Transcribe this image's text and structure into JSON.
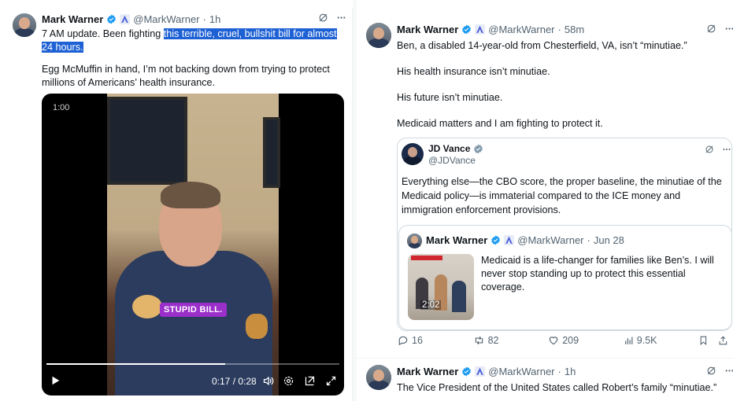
{
  "left_tweet": {
    "author_name": "Mark Warner",
    "handle": "@MarkWarner",
    "time": "1h",
    "text_plain": "7 AM update. Been fighting ",
    "text_highlight": "this terrible, cruel, bullshit bill for almost 24 hours.",
    "text_p2": "Egg McMuffin in hand, I’m not backing down from trying to protect millions of Americans’ health insurance.",
    "video": {
      "corner_time": "1:00",
      "caption": "STUPID BILL.",
      "time_display": "0:17 / 0:28",
      "progress": 0.61
    }
  },
  "right_tweet": {
    "author_name": "Mark Warner",
    "handle": "@MarkWarner",
    "time": "58m",
    "lines": [
      "Ben, a disabled 14-year-old from Chesterfield, VA, isn’t “minutiae.”",
      "His health insurance isn’t minutiae.",
      "His future isn’t minutiae.",
      "Medicaid matters and I am fighting to protect it."
    ],
    "quote": {
      "author_name": "JD Vance",
      "handle": "@JDVance",
      "text": "Everything else—the CBO score, the proper baseline, the minutiae of the Medicaid policy—is immaterial compared to the ICE money and immigration enforcement provisions.",
      "nested": {
        "author_name": "Mark Warner",
        "handle": "@MarkWarner",
        "date": "Jun 28",
        "text": "Medicaid is a life-changer for families like Ben’s. I will never stop standing up to protect this essential coverage.",
        "video_duration": "2:02"
      }
    },
    "stats": {
      "replies": "16",
      "reposts": "82",
      "likes": "209",
      "views": "9.5K"
    }
  },
  "next_tweet": {
    "author_name": "Mark Warner",
    "handle": "@MarkWarner",
    "time": "1h",
    "text": "The Vice President of the United States called Robert’s family “minutiae.”"
  },
  "colors": {
    "verified": "#1d9bf0",
    "gov_badge": "#4a5fd6",
    "highlight": "#1d61d4",
    "caption_bg": "#9a2fc9",
    "muted": "#536471"
  },
  "icons": [
    "verified-badge-icon",
    "gov-affiliate-icon",
    "grok-icon",
    "more-icon",
    "play-icon",
    "volume-icon",
    "settings-icon",
    "pip-icon",
    "fullscreen-icon",
    "reply-icon",
    "repost-icon",
    "like-icon",
    "views-icon",
    "bookmark-icon",
    "share-icon"
  ]
}
